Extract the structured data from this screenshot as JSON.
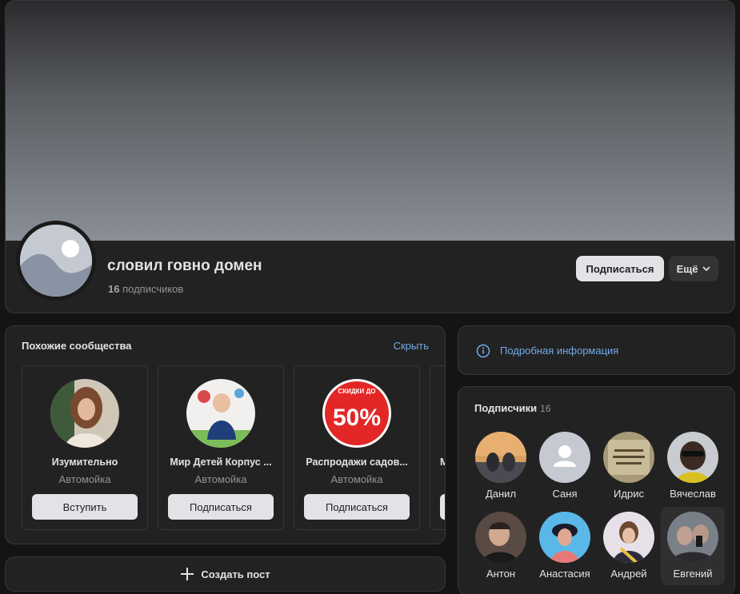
{
  "group": {
    "name": "словил говно домен",
    "subscribers_count": "16",
    "subscribers_word": "подписчиков",
    "subscribe_label": "Подписаться",
    "more_label": "Ещё"
  },
  "similar": {
    "title": "Похожие сообщества",
    "hide_label": "Скрыть",
    "items": [
      {
        "name": "Изумительно",
        "category": "Автомойка",
        "button": "Вступить"
      },
      {
        "name": "Мир Детей Корпус ...",
        "category": "Автомойка",
        "button": "Подписаться"
      },
      {
        "name": "Распродажи садов...",
        "category": "Автомойка",
        "button": "Подписаться"
      },
      {
        "name": "М",
        "category": "",
        "button": ""
      }
    ],
    "sale_badge_top": "СКИДКИ ДО",
    "sale_badge_value": "50%"
  },
  "create_post_label": "Создать пост",
  "info_label": "Подробная информация",
  "followers": {
    "title": "Подписчики",
    "count": "16",
    "items": [
      {
        "name": "Данил"
      },
      {
        "name": "Саня"
      },
      {
        "name": "Идрис"
      },
      {
        "name": "Вячеслав"
      },
      {
        "name": "Антон"
      },
      {
        "name": "Анастасия"
      },
      {
        "name": "Андрей"
      },
      {
        "name": "Евгений"
      }
    ]
  },
  "colors": {
    "background": "#141414",
    "card": "#222222",
    "accent_link": "#71aaeb",
    "button_light": "#e1e3e6"
  }
}
